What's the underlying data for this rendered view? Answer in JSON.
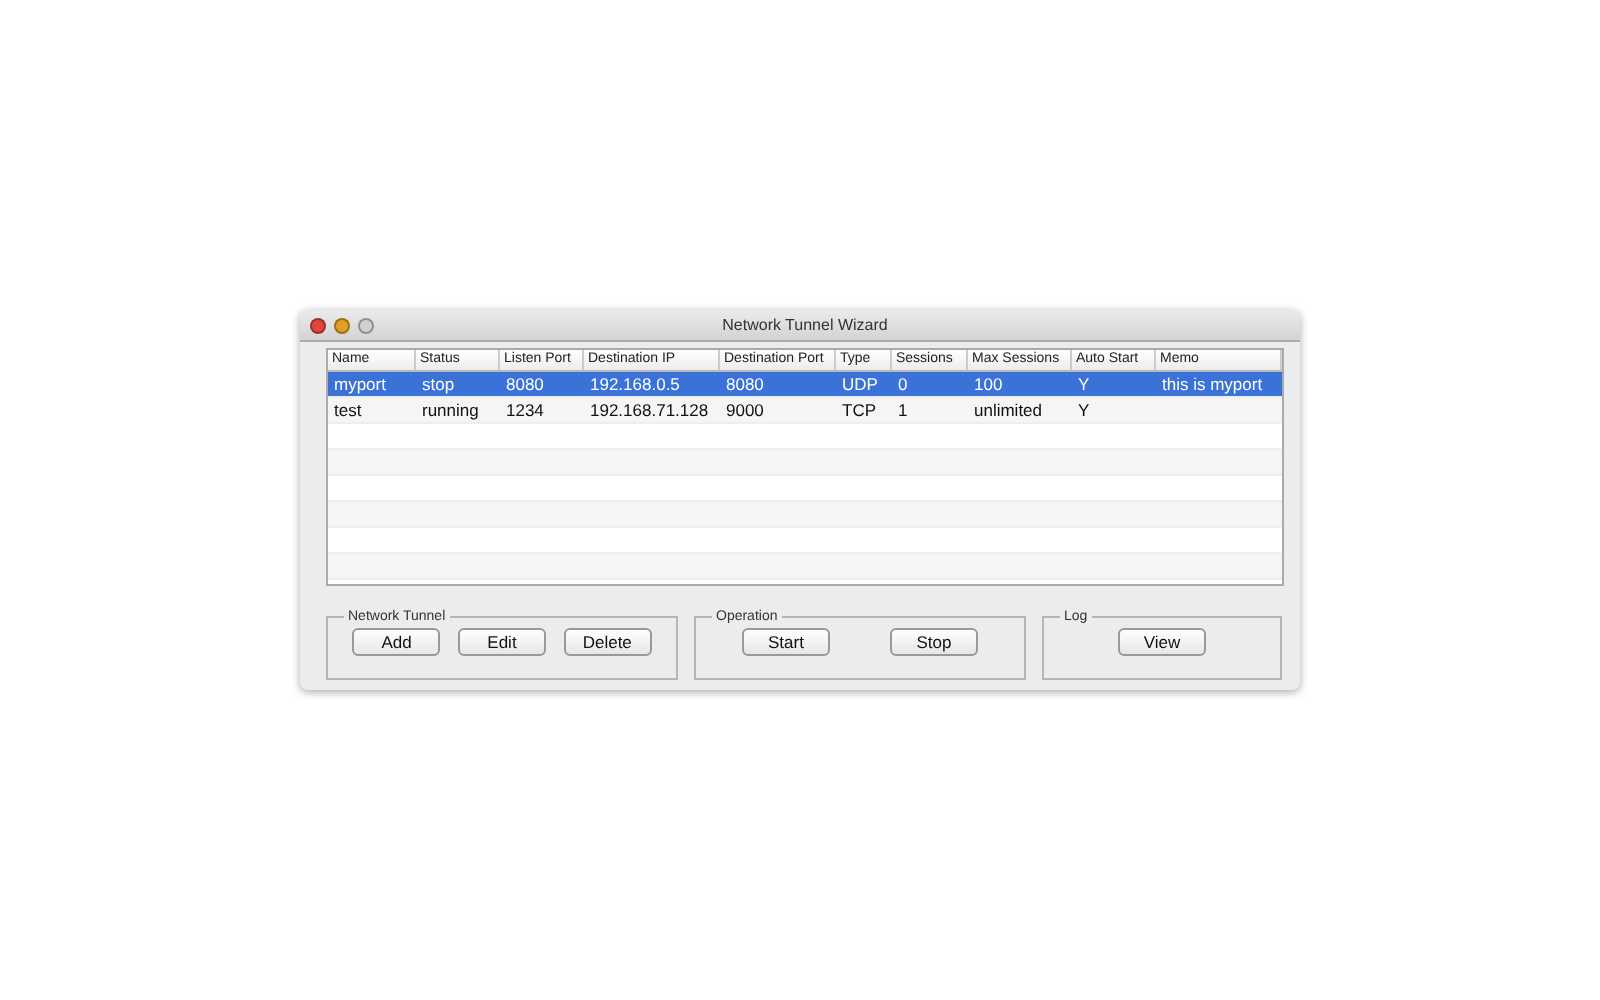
{
  "window": {
    "title": "Network Tunnel Wizard"
  },
  "table": {
    "columns": [
      "Name",
      "Status",
      "Listen Port",
      "Destination IP",
      "Destination Port",
      "Type",
      "Sessions",
      "Max Sessions",
      "Auto Start",
      "Memo"
    ],
    "rows": [
      {
        "selected": true,
        "cells": [
          "myport",
          "stop",
          "8080",
          "192.168.0.5",
          "8080",
          "UDP",
          "0",
          "100",
          "Y",
          "this is myport"
        ]
      },
      {
        "selected": false,
        "cells": [
          "test",
          "running",
          "1234",
          "192.168.71.128",
          "9000",
          "TCP",
          "1",
          "unlimited",
          "Y",
          ""
        ]
      }
    ]
  },
  "groups": [
    {
      "title": "Network Tunnel",
      "buttons": [
        "Add",
        "Edit",
        "Delete"
      ]
    },
    {
      "title": "Operation",
      "buttons": [
        "Start",
        "Stop"
      ]
    },
    {
      "title": "Log",
      "buttons": [
        "View"
      ]
    }
  ]
}
